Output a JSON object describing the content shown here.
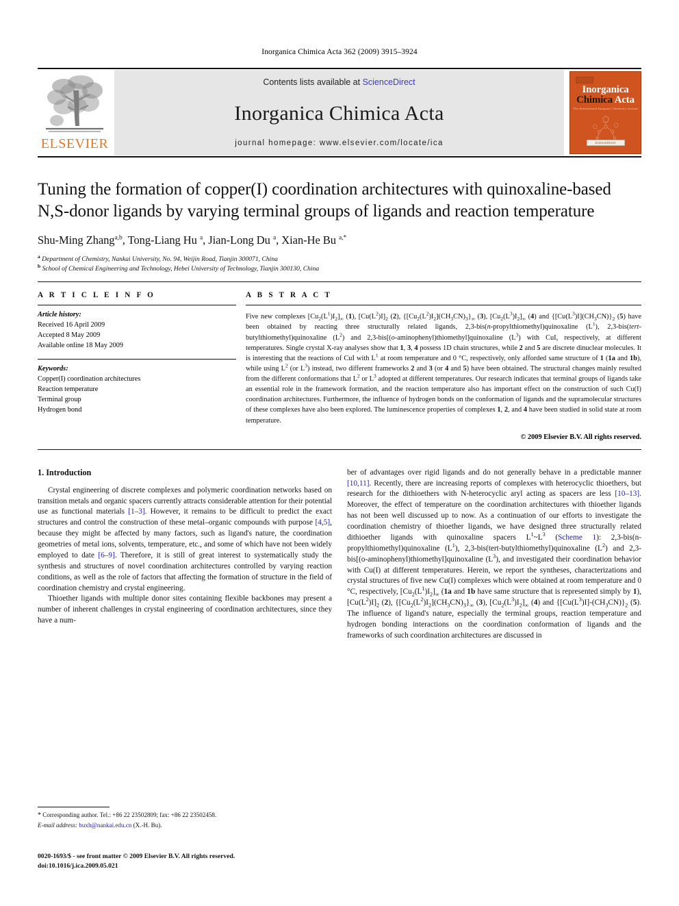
{
  "running_head": "Inorganica Chimica Acta 362 (2009) 3915–3924",
  "masthead": {
    "contents_prefix": "Contents lists available at ",
    "sciencedirect": "ScienceDirect",
    "journal_name": "Inorganica Chimica Acta",
    "homepage": "journal homepage: www.elsevier.com/locate/ica",
    "elsevier_wordmark": "ELSEVIER",
    "cover": {
      "line1": "Inorganica",
      "line2a": "Chimica",
      "line2b": "Acta",
      "subtitle": "The International Inorganic Chemistry Journal",
      "badge": "ScienceDirect"
    }
  },
  "title": "Tuning the formation of copper(I) coordination architectures with quinoxaline-based N,S-donor ligands by varying terminal groups of ligands and reaction temperature",
  "authors_html": "Shu-Ming Zhang<sup>a,b</sup>, Tong-Liang Hu <sup>a</sup>, Jian-Long Du <sup>a</sup>, Xian-He Bu <sup>a,</sup><sup>*</sup>",
  "affiliations": [
    "Department of Chemistry, Nankai University, No. 94, Weijin Road, Tianjin 300071, China",
    "School of Chemical Engineering and Technology, Hebei University of Technology, Tianjin 300130, China"
  ],
  "article_info": {
    "heading": "A R T I C L E    I N F O",
    "history_label": "Article history:",
    "history": [
      "Received 16 April 2009",
      "Accepted 8 May 2009",
      "Available online 18 May 2009"
    ],
    "keywords_label": "Keywords:",
    "keywords": [
      "Copper(I) coordination architectures",
      "Reaction temperature",
      "Terminal group",
      "Hydrogen bond"
    ]
  },
  "abstract": {
    "heading": "A B S T R A C T",
    "html": "Five new complexes [Cu<sub>2</sub>(L<sup>1</sup>)I<sub>2</sub>]<sub>∞</sub> (<b>1</b>), [Cu(L<sup>2</sup>)I]<sub>2</sub> (<b>2</b>), {[Cu<sub>2</sub>(L<sup>2</sup>)I<sub>2</sub>](CH<sub>3</sub>CN)<sub>3</sub>}<sub>∞</sub> (<b>3</b>), [Cu<sub>2</sub>(L<sup>3</sup>)I<sub>2</sub>]<sub>∞</sub> (<b>4</b>) and {[Cu(L<sup>3</sup>)I](CH<sub>3</sub>CN)}<sub>2</sub> (<b>5</b>) have been obtained by reacting three structurally related ligands, 2,3-bis(<i>n</i>-propylthiomethyl)quinoxaline (L<sup>1</sup>), 2,3-bis(<i>tert</i>-butylthiomethyl)quinoxaline (L<sup>2</sup>) and 2,3-bis[(<i>o</i>-aminophenyl)thiomethyl]quinoxaline (L<sup>3</sup>) with CuI, respectively, at different temperatures. Single crystal X-ray analyses show that <b>1</b>, <b>3</b>, <b>4</b> possess 1D chain structures, while <b>2</b> and <b>5</b> are discrete dinuclear molecules. It is interesting that the reactions of CuI with L<sup>1</sup> at room temperature and 0 °C, respectively, only afforded same structure of <b>1</b> (<b>1a</b> and <b>1b</b>), while using L<sup>2</sup> (or L<sup>3</sup>) instead, two different frameworks <b>2</b> and <b>3</b> (or <b>4</b> and <b>5</b>) have been obtained. The structural changes mainly resulted from the different conformations that L<sup>2</sup> or L<sup>3</sup> adopted at different temperatures. Our research indicates that terminal groups of ligands take an essential role in the framework formation, and the reaction temperature also has important effect on the construction of such Cu(I) coordination architectures. Furthermore, the influence of hydrogen bonds on the conformation of ligands and the supramolecular structures of these complexes have also been explored. The luminescence properties of complexes <b>1</b>, <b>2</b>, and <b>4</b> have been studied in solid state at room temperature.",
    "copyright": "© 2009 Elsevier B.V. All rights reserved."
  },
  "body": {
    "section_heading": "1. Introduction",
    "left_paragraphs_html": [
      "Crystal engineering of discrete complexes and polymeric coordination networks based on transition metals and organic spacers currently attracts considerable attention for their potential use as functional materials <span class=\"ref\">[1–3]</span>. However, it remains to be difficult to predict the exact structures and control the construction of these metal–organic compounds with purpose <span class=\"ref\">[4,5]</span>, because they might be affected by many factors, such as ligand's nature, the coordination geometries of metal ions, solvents, temperature, etc., and some of which have not been widely employed to date <span class=\"ref\">[6–9]</span>. Therefore, it is still of great interest to systematically study the synthesis and structures of novel coordination architectures controlled by varying reaction conditions, as well as the role of factors that affecting the formation of structure in the field of coordination chemistry and crystal engineering.",
      "Thioether ligands with multiple donor sites containing flexible backbones may present a number of inherent challenges in crystal engineering of coordination architectures, since they have a num-"
    ],
    "right_paragraphs_html": [
      "ber of advantages over rigid ligands and do not generally behave in a predictable manner <span class=\"ref\">[10,11]</span>. Recently, there are increasing reports of complexes with heterocyclic thioethers, but research for the dithioethers with N-heterocyclic aryl acting as spacers are less <span class=\"ref\">[10–13]</span>. Moreover, the effect of temperature on the coordination architectures with thioether ligands has not been well discussed up to now. As a continuation of our efforts to investigate the coordination chemistry of thioether ligands, we have designed three structurally related dithioether ligands with quinoxaline spacers L<sup>1</sup>~L<sup>3</sup> (<span class=\"ref\">Scheme 1</span>): 2,3-bis(n-propylthiomethyl)quinoxaline (L<sup>1</sup>), 2,3-bis(tert-butylthiomethyl)quinoxaline (L<sup>2</sup>) and 2,3-bis[(o-aminophenyl)thiomethyl]quinoxaline (L<sup>3</sup>), and investigated their coordination behavior with Cu(I) at different temperatures. Herein, we report the syntheses, characterizations and crystal structures of five new Cu(I) complexes which were obtained at room temperature and 0 °C, respectively, [Cu<sub>2</sub>(L<sup>1</sup>)I<sub>2</sub>]<sub>∞</sub> (<b>1a</b> and <b>1b</b> have same structure that is represented simply by <b>1</b>), [Cu(L<sup>2</sup>)I]<sub>2</sub> (<b>2</b>), {[Cu<sub>2</sub>(L<sup>2</sup>)I<sub>2</sub>](CH<sub>3</sub>CN)<sub>3</sub>}<sub>∞</sub> (<b>3</b>), [Cu<sub>2</sub>(L<sup>3</sup>)I<sub>2</sub>]<sub>∞</sub> (<b>4</b>) and {[Cu(L<sup>3</sup>)I]-(CH<sub>3</sub>CN)}<sub>2</sub> (<b>5</b>). The influence of ligand's nature, especially the terminal groups, reaction temperature and hydrogen bonding interactions on the coordination conformation of ligands and the frameworks of such coordination architectures are discussed in"
    ]
  },
  "footnotes": {
    "corresponding_html": "<span style=\"font-size:10px\">*</span> Corresponding author. Tel.: +86 22 23502809; fax: +86 22 23502458.",
    "email_html": "<i>E-mail address:</i> <span class=\"fn-mail\">buxh@nankai.edu.cn</span> (X.-H. Bu)."
  },
  "issn": {
    "line1": "0020-1693/$ - see front matter © 2009 Elsevier B.V. All rights reserved.",
    "line2": "doi:10.1016/j.ica.2009.05.021"
  }
}
